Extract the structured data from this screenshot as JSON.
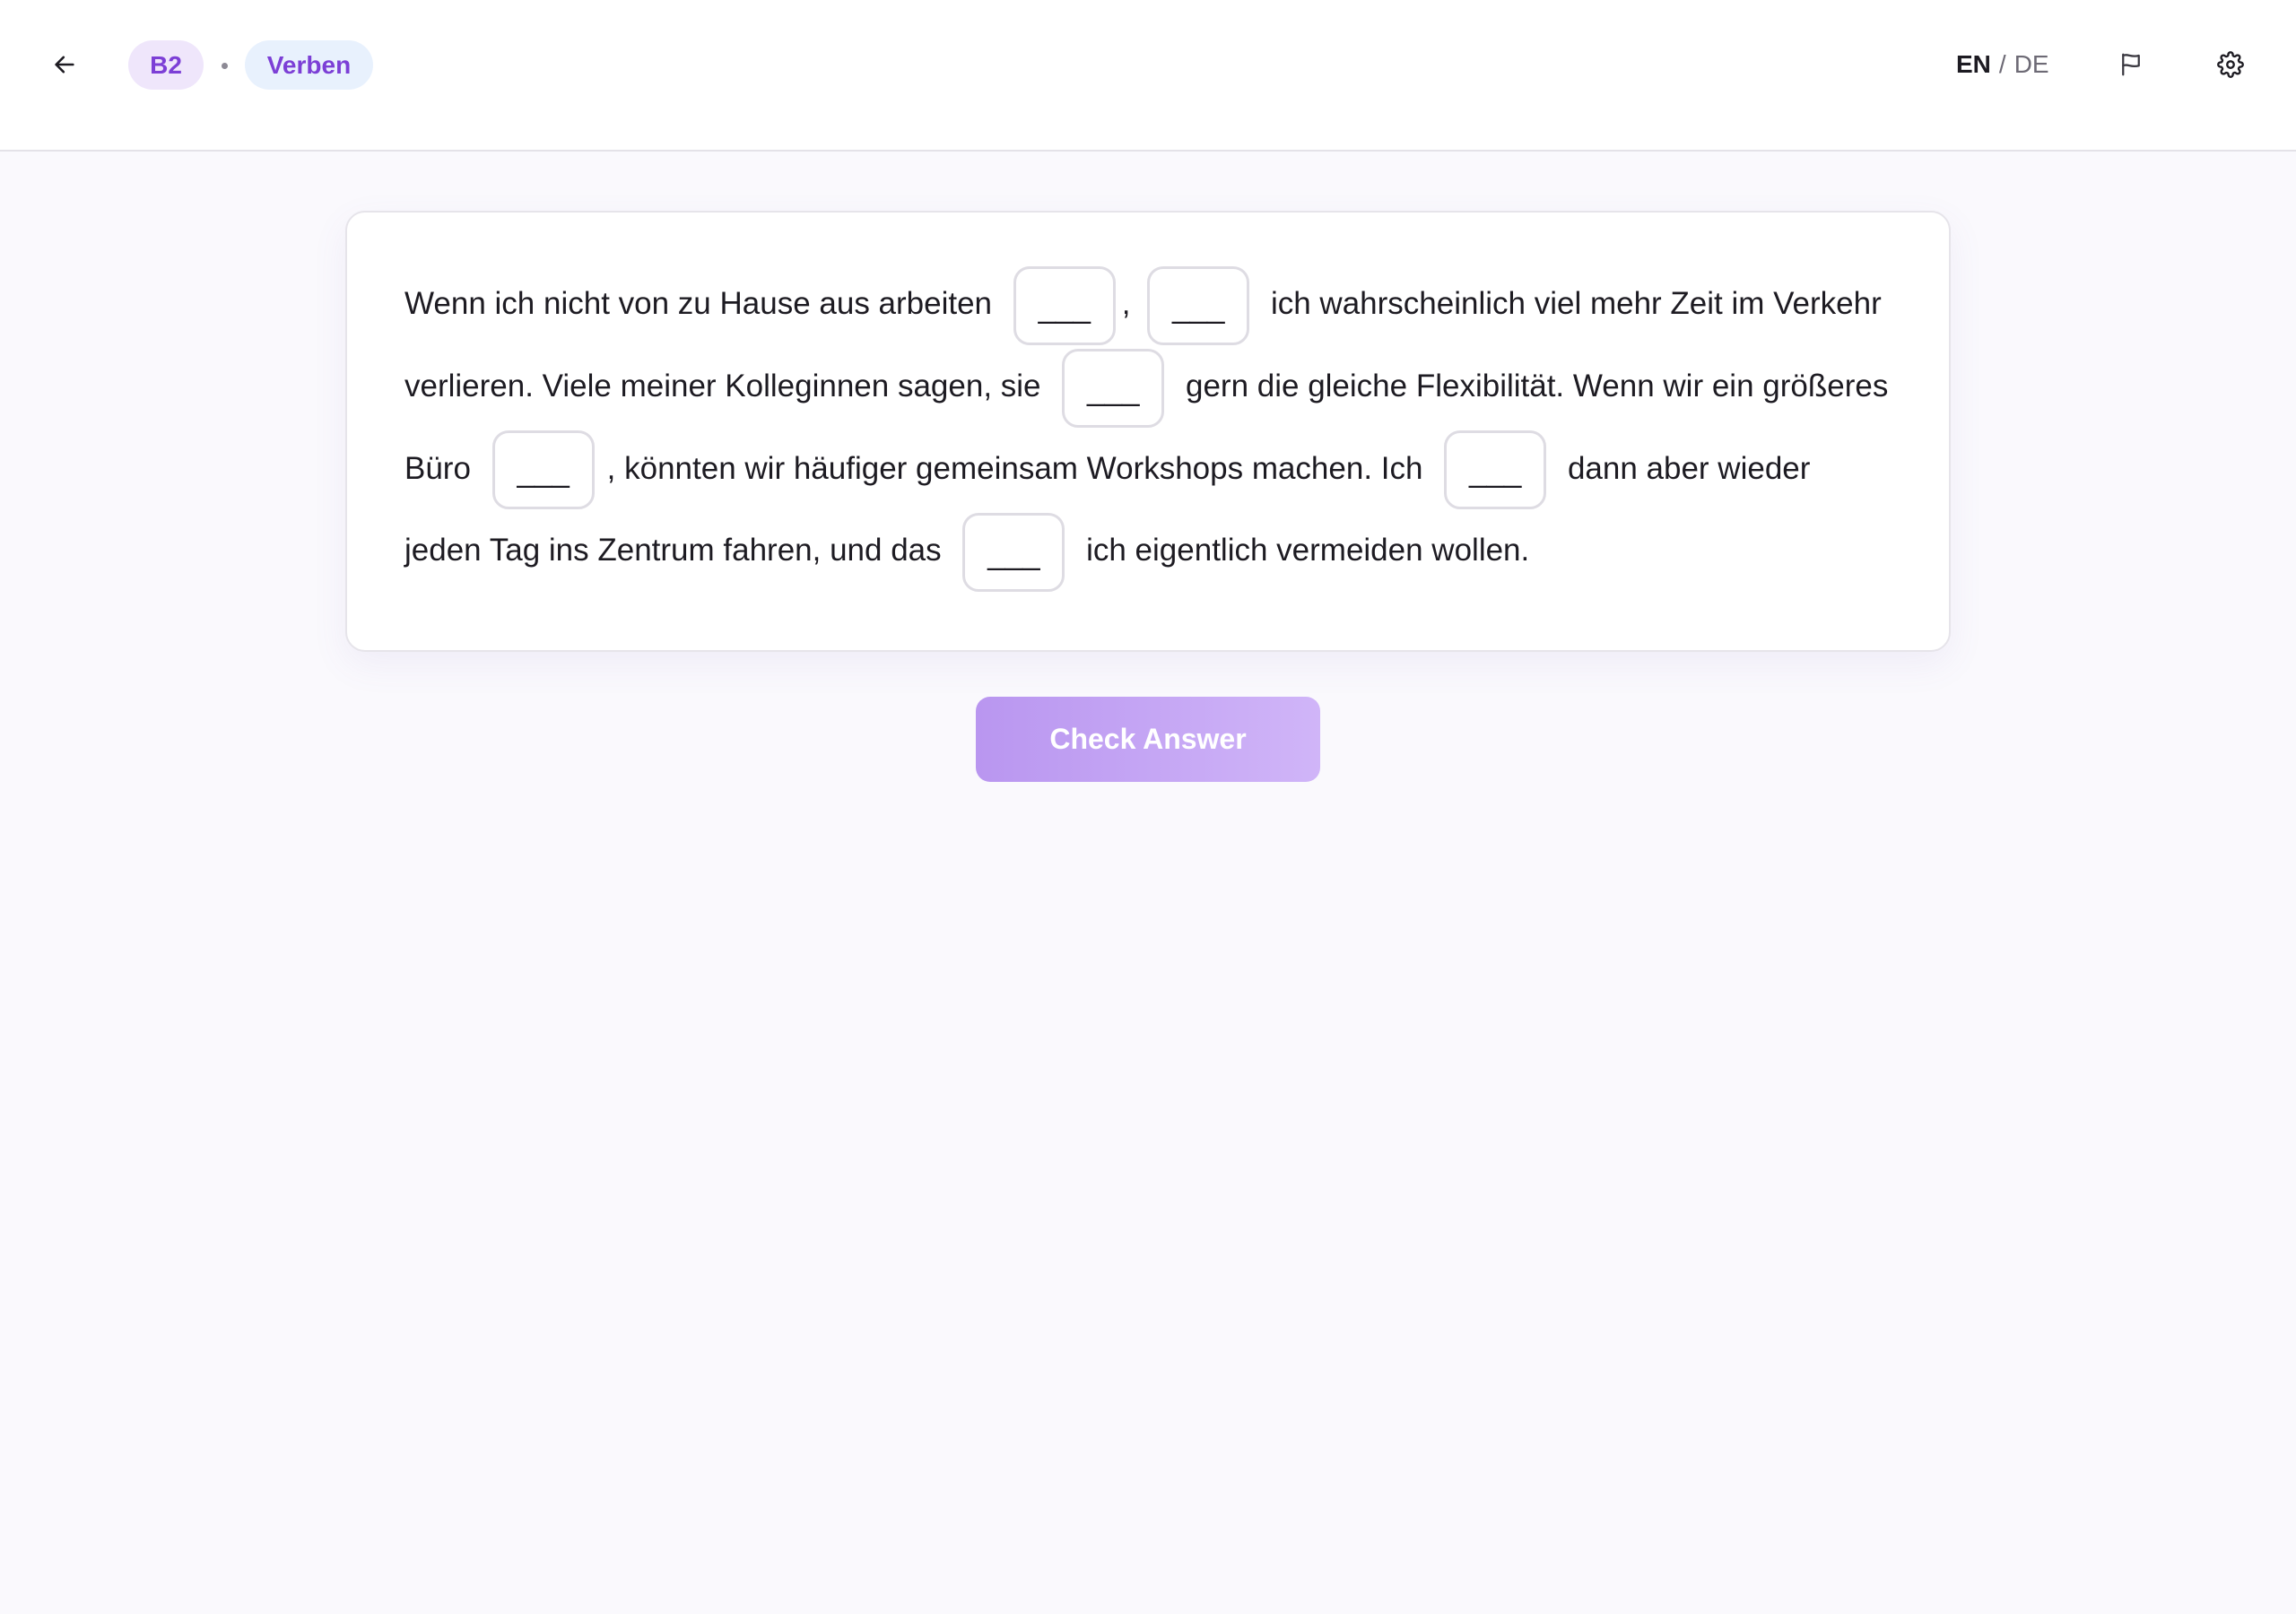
{
  "header": {
    "back_icon": "arrow-left-icon",
    "level_badge": "B2",
    "separator": "•",
    "topic_badge": "Verben",
    "lang_en": "EN",
    "lang_sep": "/",
    "lang_de": "DE",
    "flag_icon": "flag-icon",
    "settings_icon": "gear-icon"
  },
  "exercise": {
    "segments": [
      "Wenn ich nicht von zu Hause aus arbeiten",
      ",",
      "ich wahrscheinlich viel mehr Zeit im Verkehr verlieren. Viele meiner Kolleginnen sagen, sie",
      "gern die gleiche Flexibilität. Wenn wir ein größeres Büro",
      ", könnten wir häufiger gemeinsam Workshops machen. Ich",
      "dann aber wieder jeden Tag ins Zentrum fahren, und das",
      "ich eigentlich vermeiden wollen."
    ],
    "blank_placeholder": "___"
  },
  "actions": {
    "check_label": "Check Answer"
  },
  "colors": {
    "accent": "#7c3fd6",
    "button_gradient_start": "#b996f0",
    "button_gradient_end": "#d0b5f8",
    "background": "#faf9fd"
  }
}
